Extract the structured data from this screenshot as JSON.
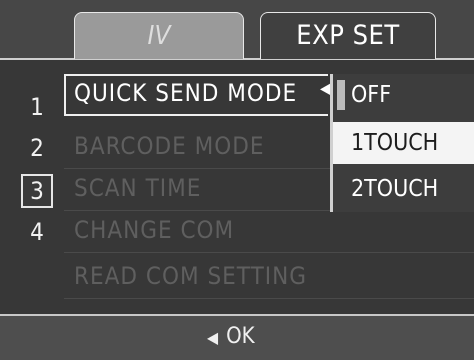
{
  "tabs": [
    {
      "label": "IV"
    },
    {
      "label": "EXP SET"
    }
  ],
  "menu": {
    "numbers": [
      "1",
      "2",
      "3",
      "4"
    ],
    "items": [
      {
        "label": "QUICK SEND MODE"
      },
      {
        "label": "BARCODE MODE"
      },
      {
        "label": "SCAN TIME"
      },
      {
        "label": "CHANGE COM"
      },
      {
        "label": "READ COM SETTING"
      }
    ]
  },
  "options": [
    {
      "label": "OFF"
    },
    {
      "label": "1TOUCH"
    },
    {
      "label": "2TOUCH"
    }
  ],
  "footer": {
    "ok_label": "OK"
  },
  "icons": {
    "selection_arrow": "left-triangle-icon",
    "ok_arrow": "left-triangle-icon"
  }
}
